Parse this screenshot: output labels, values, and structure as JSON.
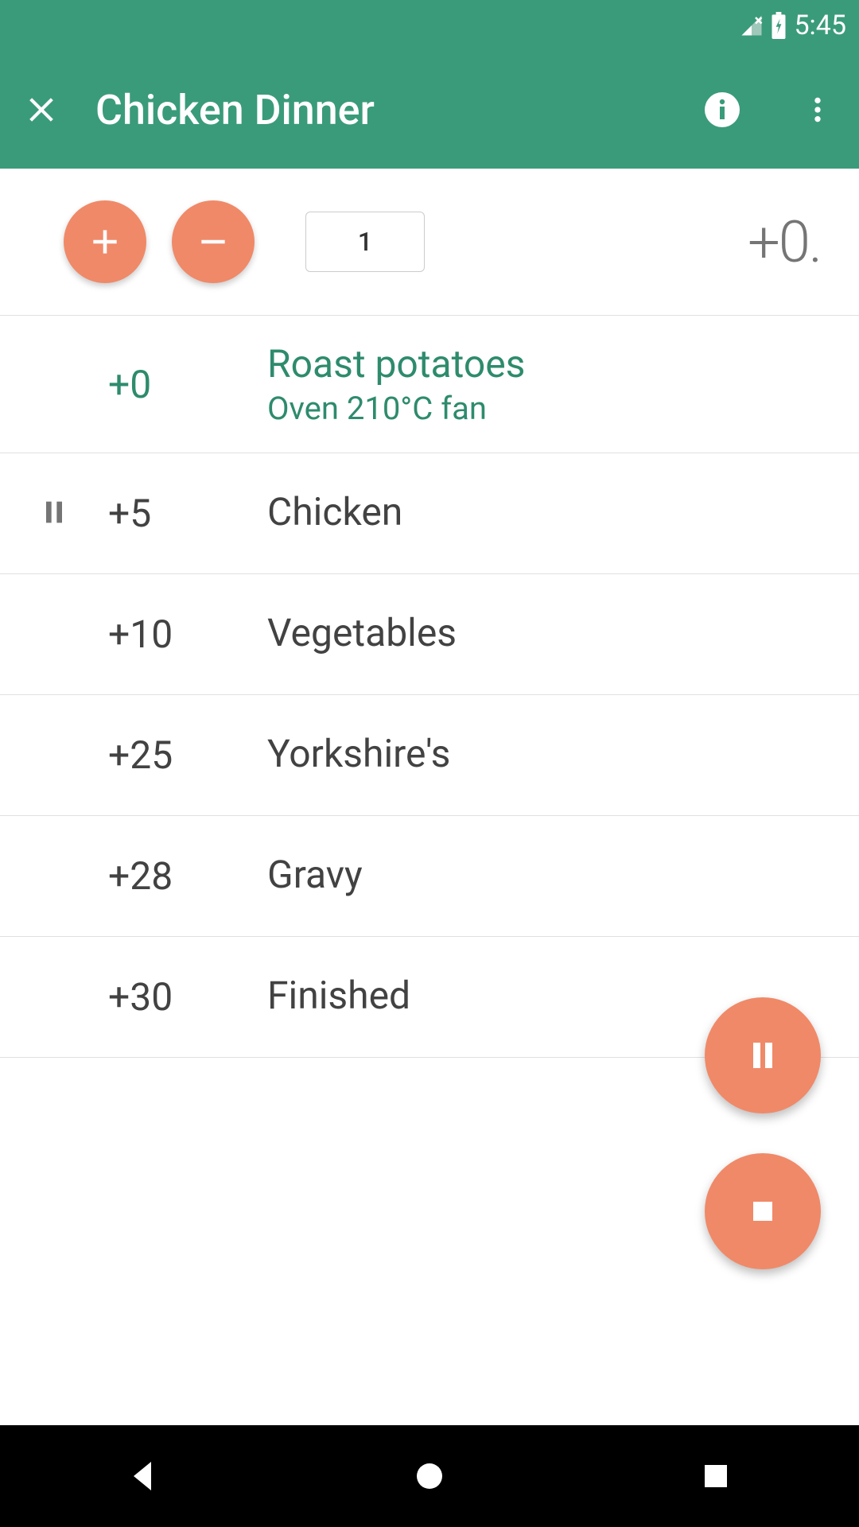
{
  "status_bar": {
    "time": "5:45"
  },
  "header": {
    "title": "Chicken Dinner"
  },
  "controls": {
    "quantity": "1",
    "timer": "+0."
  },
  "steps": [
    {
      "time": "+0",
      "title": "Roast potatoes",
      "subtitle": "Oven 210°C fan",
      "active": true,
      "has_pause": false
    },
    {
      "time": "+5",
      "title": "Chicken",
      "subtitle": "",
      "active": false,
      "has_pause": true
    },
    {
      "time": "+10",
      "title": "Vegetables",
      "subtitle": "",
      "active": false,
      "has_pause": false
    },
    {
      "time": "+25",
      "title": "Yorkshire's",
      "subtitle": "",
      "active": false,
      "has_pause": false
    },
    {
      "time": "+28",
      "title": "Gravy",
      "subtitle": "",
      "active": false,
      "has_pause": false
    },
    {
      "time": "+30",
      "title": "Finished",
      "subtitle": "",
      "active": false,
      "has_pause": false
    }
  ]
}
